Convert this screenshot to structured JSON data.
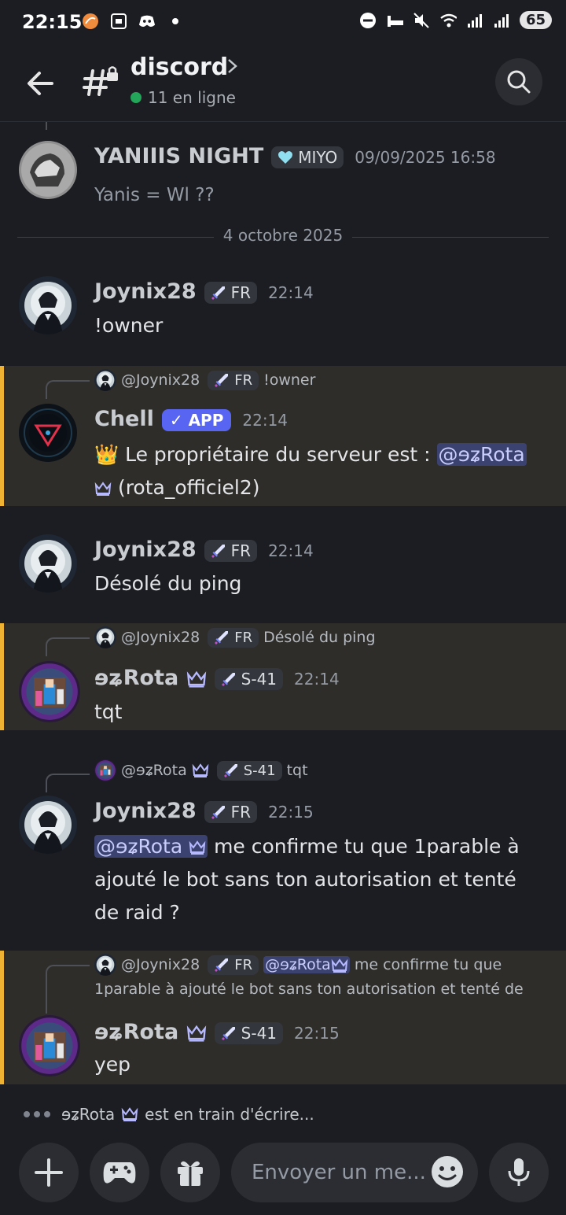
{
  "status": {
    "time": "22:15",
    "battery": "65"
  },
  "header": {
    "channel": "discord",
    "online": "11 en ligne"
  },
  "messages": [
    {
      "username": "YANIIIS NIGHT",
      "tag": "MIYO",
      "timestamp": "09/09/2025 16:58",
      "text": "Yanis = Wl ??"
    },
    {
      "username": "Joynix28",
      "tag": "FR",
      "timestamp": "22:14",
      "text": "!owner"
    },
    {
      "reply_user": "@Joynix28",
      "reply_tag": "FR",
      "reply_text": "!owner",
      "username": "Chell",
      "app_tag": "✓ APP",
      "timestamp": "22:14",
      "text_before": "👑 Le propriétaire du serveur est : ",
      "mention": "@ɘʑRota",
      "text_after": "(rota_officiel2)"
    },
    {
      "username": "Joynix28",
      "tag": "FR",
      "timestamp": "22:14",
      "text": "Désolé du ping"
    },
    {
      "reply_user": "@Joynix28",
      "reply_tag": "FR",
      "reply_text": "Désolé du ping",
      "username": "ɘʑRota",
      "tag": "S-41",
      "timestamp": "22:14",
      "text": "tqt"
    },
    {
      "reply_user": "@ɘʑRota",
      "reply_tag": "S-41",
      "reply_text": "tqt",
      "username": "Joynix28",
      "tag": "FR",
      "timestamp": "22:15",
      "mention": "@ɘʑRota",
      "text": "me confirme tu que 1parable à ajouté le bot sans ton autorisation et tenté de raid ?"
    },
    {
      "reply_user": "@Joynix28",
      "reply_tag": "FR",
      "reply_mention": "@ɘʑRota",
      "reply_text_1": "me confirme tu que",
      "reply_text_2": "1parable à ajouté le bot sans ton autorisation et tenté de",
      "username": "ɘʑRota",
      "tag": "S-41",
      "timestamp": "22:15",
      "text": "yep"
    }
  ],
  "date_divider": "4 octobre 2025",
  "typing": {
    "user": "ɘʑRota",
    "text": "est en train d'écrire..."
  },
  "composer": {
    "placeholder": "Envoyer un me..."
  },
  "colors": {
    "background": "#1c1d22",
    "highlight": "#f0b232",
    "mention_bg": "#3c4270",
    "app_badge": "#5865f2",
    "online": "#23a55a"
  }
}
